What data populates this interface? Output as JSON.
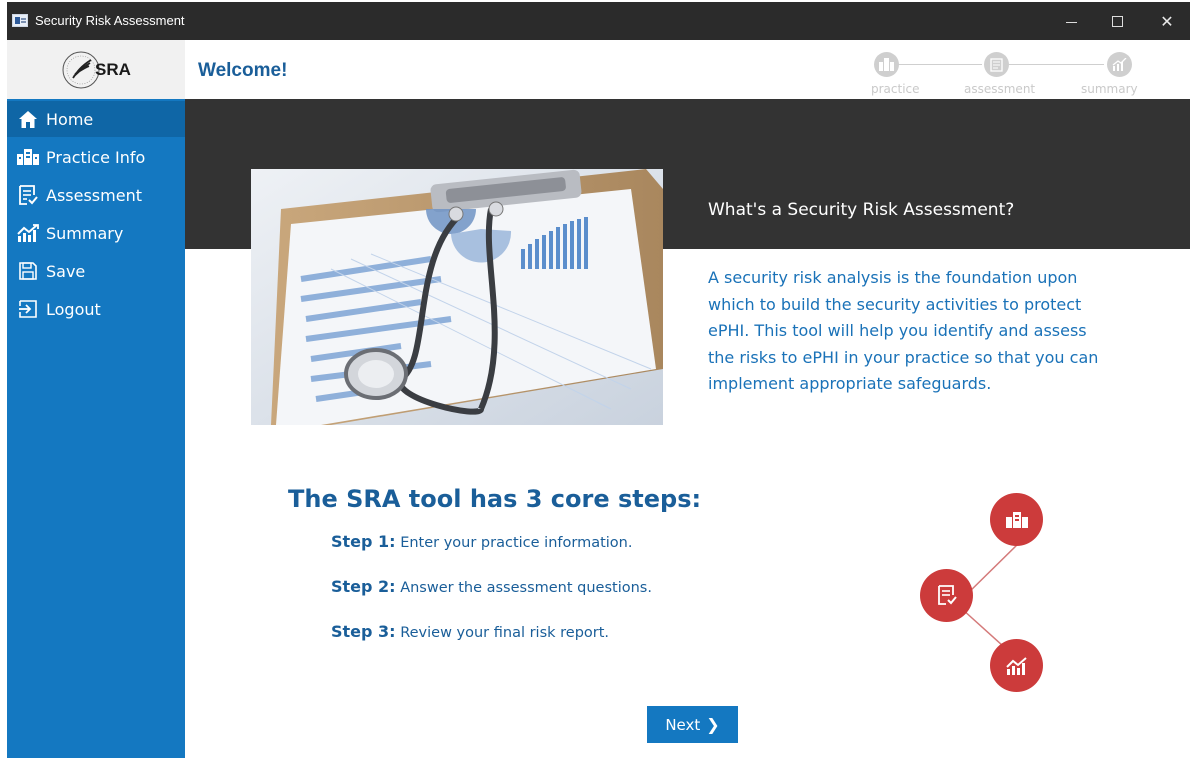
{
  "window": {
    "title": "Security Risk Assessment",
    "min_icon": "minimize-icon",
    "max_icon": "maximize-icon",
    "close_icon": "close-icon",
    "close_glyph": "✕"
  },
  "header": {
    "logo_text": "SRA",
    "page_title": "Welcome!",
    "progress_steps": [
      {
        "label": "practice",
        "icon": "building-icon"
      },
      {
        "label": "assessment",
        "icon": "checklist-icon"
      },
      {
        "label": "summary",
        "icon": "chart-icon"
      }
    ]
  },
  "sidebar": {
    "items": [
      {
        "label": "Home",
        "icon": "home-icon",
        "active": true
      },
      {
        "label": "Practice Info",
        "icon": "building-icon",
        "active": false
      },
      {
        "label": "Assessment",
        "icon": "checklist-icon",
        "active": false
      },
      {
        "label": "Summary",
        "icon": "chart-icon",
        "active": false
      },
      {
        "label": "Save",
        "icon": "save-icon",
        "active": false
      },
      {
        "label": "Logout",
        "icon": "logout-icon",
        "active": false
      }
    ]
  },
  "main": {
    "intro_title": "What's a Security Risk Assessment?",
    "intro_body": "A security risk analysis is the foundation upon which to build the security activities to protect ePHI.  This tool will help you identify and assess the risks to ePHI in your practice so that you can implement appropriate safeguards.",
    "steps_title": "The SRA tool has 3 core steps:",
    "steps": [
      {
        "num": "Step 1:",
        "text": "Enter your practice information."
      },
      {
        "num": "Step 2:",
        "text": "Answer the assessment questions."
      },
      {
        "num": "Step 3:",
        "text": "Review your final risk report."
      }
    ],
    "next_label": "Next",
    "next_glyph": "❯"
  },
  "colors": {
    "sidebar": "#1478c1",
    "sidebar_active": "#0f66a6",
    "accent_blue": "#1a5e99",
    "banner": "#333333",
    "step_red": "#cc3b3b",
    "progress_grey": "#cfcfcf"
  }
}
